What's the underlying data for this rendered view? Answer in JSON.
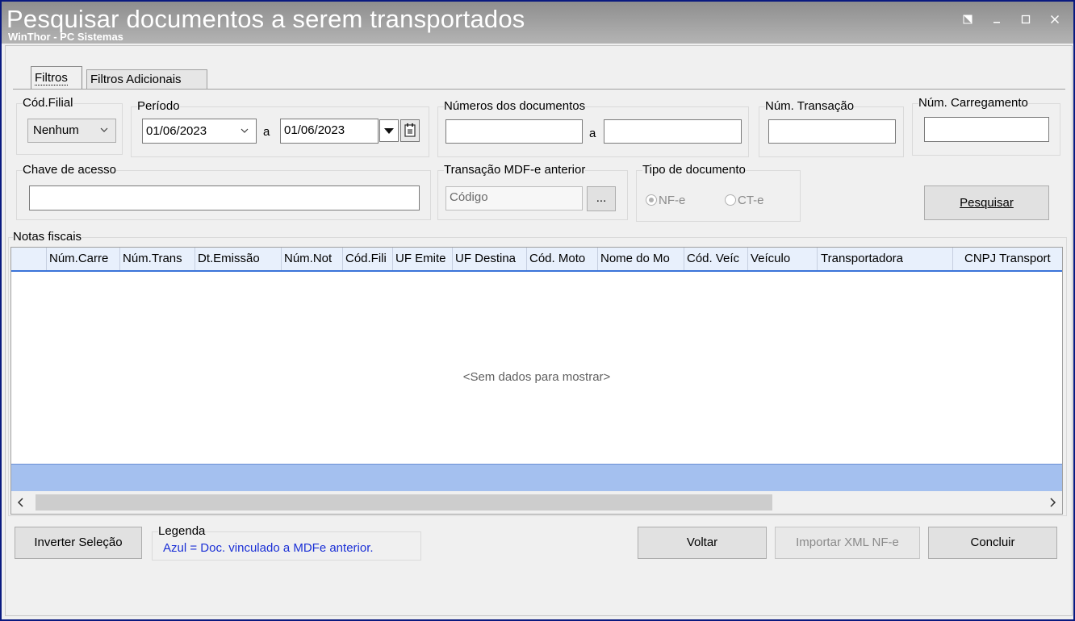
{
  "window": {
    "title": "Pesquisar documentos a serem transportados",
    "subtitle": "WinThor - PC Sistemas"
  },
  "tabs": [
    {
      "label": "Filtros",
      "active": true
    },
    {
      "label": "Filtros Adicionais",
      "active": false
    }
  ],
  "filters": {
    "filial": {
      "label": "Cód.Filial",
      "value": "Nenhum"
    },
    "periodo": {
      "label": "Período",
      "from": "01/06/2023",
      "separator": "a",
      "to": "01/06/2023"
    },
    "numeros": {
      "label": "Números dos documentos",
      "from": "",
      "separator": "a",
      "to": ""
    },
    "transacao": {
      "label": "Núm. Transação",
      "value": ""
    },
    "carregamento": {
      "label": "Núm. Carregamento",
      "value": ""
    },
    "chave": {
      "label": "Chave de acesso",
      "value": ""
    },
    "mdfe": {
      "label": "Transação MDF-e anterior",
      "placeholder": "Código",
      "browse_label": "..."
    },
    "tipo": {
      "label": "Tipo de documento",
      "options": [
        "NF-e",
        "CT-e"
      ],
      "selected": "NF-e"
    },
    "search_button": "Pesquisar"
  },
  "grid": {
    "label": "Notas fiscais",
    "columns": [
      "Núm.Carre",
      "Núm.Trans",
      "Dt.Emissão",
      "Núm.Not",
      "Cód.Fili",
      "UF Emite",
      "UF Destina",
      "Cód. Moto",
      "Nome do Mo",
      "Cód. Veíc",
      "Veículo",
      "Transportadora",
      "CNPJ Transport"
    ],
    "empty_text": "<Sem dados para mostrar>"
  },
  "footer": {
    "invert_button": "Inverter Seleção",
    "legend_label": "Legenda",
    "legend_text": "Azul = Doc. vinculado a MDFe anterior.",
    "voltar_button": "Voltar",
    "import_button": "Importar XML NF-e",
    "concluir_button": "Concluir"
  },
  "colors": {
    "accent": "#3a73d8",
    "legend_text": "#1a2fd6",
    "grid_footer": "#a4c0ef"
  }
}
